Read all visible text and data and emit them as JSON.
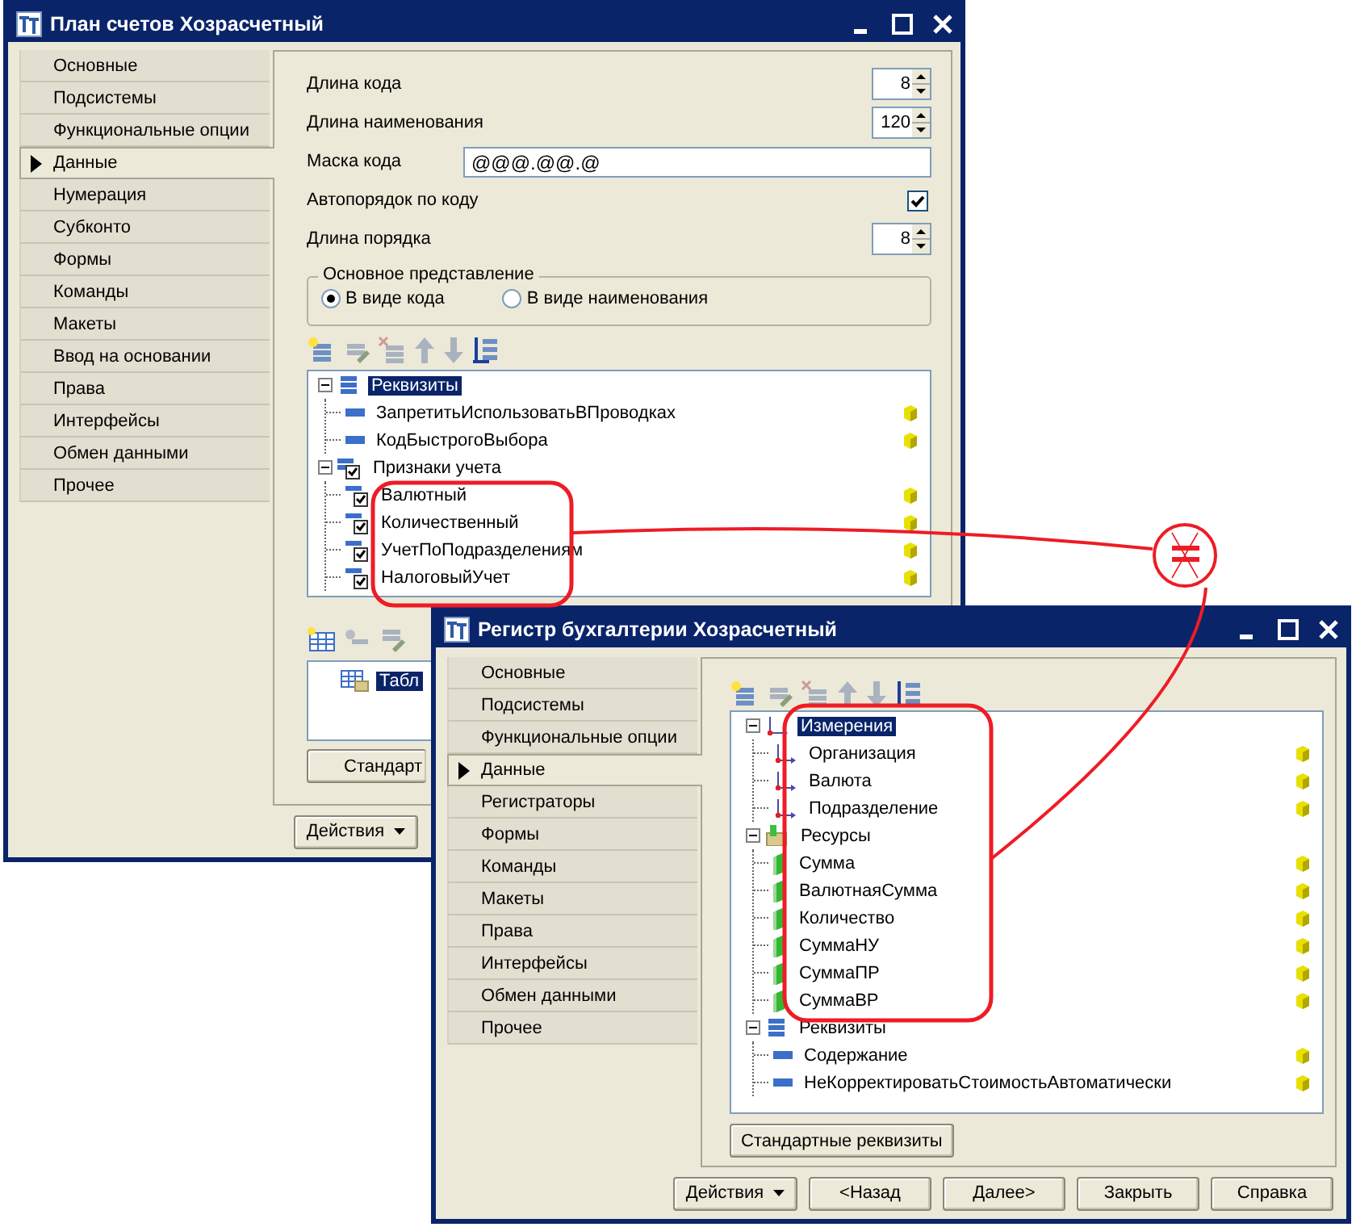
{
  "chart_of_accounts_window": {
    "title": "План счетов Хозрасчетный",
    "nav": [
      {
        "label": "Основные",
        "selected": false
      },
      {
        "label": "Подсистемы",
        "selected": false
      },
      {
        "label": "Функциональные опции",
        "selected": false
      },
      {
        "label": "Данные",
        "selected": true
      },
      {
        "label": "Нумерация",
        "selected": false
      },
      {
        "label": "Субконто",
        "selected": false
      },
      {
        "label": "Формы",
        "selected": false
      },
      {
        "label": "Команды",
        "selected": false
      },
      {
        "label": "Макеты",
        "selected": false
      },
      {
        "label": "Ввод на основании",
        "selected": false
      },
      {
        "label": "Права",
        "selected": false
      },
      {
        "label": "Интерфейсы",
        "selected": false
      },
      {
        "label": "Обмен данными",
        "selected": false
      },
      {
        "label": "Прочее",
        "selected": false
      }
    ],
    "fields": [
      {
        "kind": "spin",
        "label": "Длина кода",
        "value": "8"
      },
      {
        "kind": "spin",
        "label": "Длина наименования",
        "value": "120"
      },
      {
        "kind": "text",
        "label": "Маска кода",
        "value": "@@@.@@.@"
      },
      {
        "kind": "check",
        "label": "Автопорядок по коду",
        "checked": true
      },
      {
        "kind": "spin",
        "label": "Длина порядка",
        "value": "8"
      }
    ],
    "representation": {
      "title": "Основное представление",
      "options": [
        {
          "label": "В виде кода",
          "selected": true
        },
        {
          "label": "В виде наименования",
          "selected": false
        }
      ]
    },
    "tree": [
      {
        "label": "Реквизиты",
        "kind": "attribute-group",
        "selected": true,
        "expanded": true,
        "children": [
          {
            "label": "ЗапретитьИспользоватьВПроводках",
            "kind": "attribute",
            "selected": false
          },
          {
            "label": "КодБыстрогоВыбора",
            "kind": "attribute",
            "selected": false
          }
        ]
      },
      {
        "label": "Признаки учета",
        "kind": "flag-group",
        "checked": true,
        "selected": false,
        "expanded": true,
        "children": [
          {
            "label": "Валютный",
            "kind": "flag",
            "checked": true,
            "selected": false
          },
          {
            "label": "Количественный",
            "kind": "flag",
            "checked": true,
            "selected": false
          },
          {
            "label": "УчетПоПодразделениям",
            "kind": "flag",
            "checked": true,
            "selected": false
          },
          {
            "label": "НалоговыйУчет",
            "kind": "flag",
            "checked": true,
            "selected": false
          }
        ]
      }
    ],
    "tables": [
      {
        "label": "Табл",
        "selected": true
      }
    ],
    "standard_button": "Стандарт",
    "buttons": [
      "Действия"
    ]
  },
  "register_window": {
    "title": "Регистр бухгалтерии Хозрасчетный",
    "nav": [
      {
        "label": "Основные",
        "selected": false
      },
      {
        "label": "Подсистемы",
        "selected": false
      },
      {
        "label": "Функциональные опции",
        "selected": false
      },
      {
        "label": "Данные",
        "selected": true
      },
      {
        "label": "Регистраторы",
        "selected": false
      },
      {
        "label": "Формы",
        "selected": false
      },
      {
        "label": "Команды",
        "selected": false
      },
      {
        "label": "Макеты",
        "selected": false
      },
      {
        "label": "Права",
        "selected": false
      },
      {
        "label": "Интерфейсы",
        "selected": false
      },
      {
        "label": "Обмен данными",
        "selected": false
      },
      {
        "label": "Прочее",
        "selected": false
      }
    ],
    "tree": [
      {
        "label": "Измерения",
        "kind": "dimension-group",
        "selected": true,
        "expanded": true,
        "children": [
          {
            "label": "Организация",
            "kind": "dimension",
            "selected": false
          },
          {
            "label": "Валюта",
            "kind": "dimension",
            "selected": false
          },
          {
            "label": "Подразделение",
            "kind": "dimension",
            "selected": false
          }
        ]
      },
      {
        "label": "Ресурсы",
        "kind": "resource-group",
        "selected": false,
        "expanded": true,
        "children": [
          {
            "label": "Сумма",
            "kind": "resource",
            "selected": false
          },
          {
            "label": "ВалютнаяСумма",
            "kind": "resource",
            "selected": false
          },
          {
            "label": "Количество",
            "kind": "resource",
            "selected": false
          },
          {
            "label": "СуммаНУ",
            "kind": "resource",
            "selected": false
          },
          {
            "label": "СуммаПР",
            "kind": "resource",
            "selected": false
          },
          {
            "label": "СуммаВР",
            "kind": "resource",
            "selected": false
          }
        ]
      },
      {
        "label": "Реквизиты",
        "kind": "attribute-group",
        "selected": false,
        "expanded": true,
        "children": [
          {
            "label": "Содержание",
            "kind": "attribute",
            "selected": false
          },
          {
            "label": "НеКорректироватьСтоимостьАвтоматически",
            "kind": "attribute",
            "selected": false
          }
        ]
      }
    ],
    "standard_button": "Стандартные реквизиты",
    "buttons": [
      "Действия",
      "<Назад",
      "Далее>",
      "Закрыть",
      "Справка"
    ]
  }
}
